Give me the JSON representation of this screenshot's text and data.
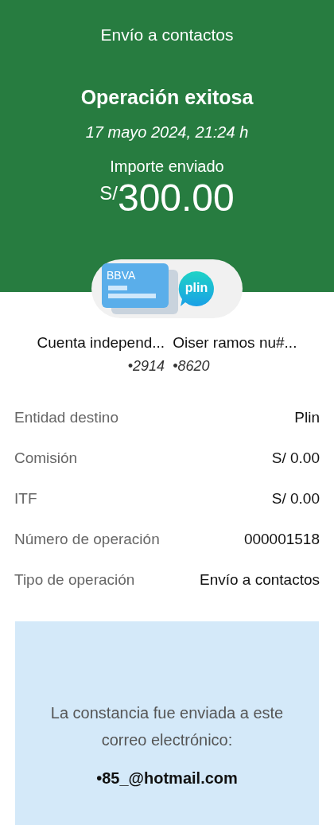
{
  "header": {
    "title": "Envío a contactos",
    "status": "Operación exitosa",
    "datetime": "17 mayo 2024, 21:24 h",
    "amount_label": "Importe enviado",
    "currency": "S/",
    "amount": "300.00"
  },
  "logos": {
    "card_label": "BBVA",
    "wallet_label": "plin"
  },
  "accounts": [
    {
      "name": "Cuenta independ...",
      "number": "•2914"
    },
    {
      "name": "Oiser ramos nu#...",
      "number": "•8620"
    }
  ],
  "details": [
    {
      "label": "Entidad destino",
      "value": "Plin"
    },
    {
      "label": "Comisión",
      "value": "S/ 0.00"
    },
    {
      "label": "ITF",
      "value": "S/ 0.00"
    },
    {
      "label": "Número de operación",
      "value": "000001518"
    },
    {
      "label": "Tipo de operación",
      "value": "Envío a contactos"
    }
  ],
  "notice": {
    "text": "La constancia fue enviada a este correo electrónico:",
    "email": "•85_@hotmail.com"
  }
}
